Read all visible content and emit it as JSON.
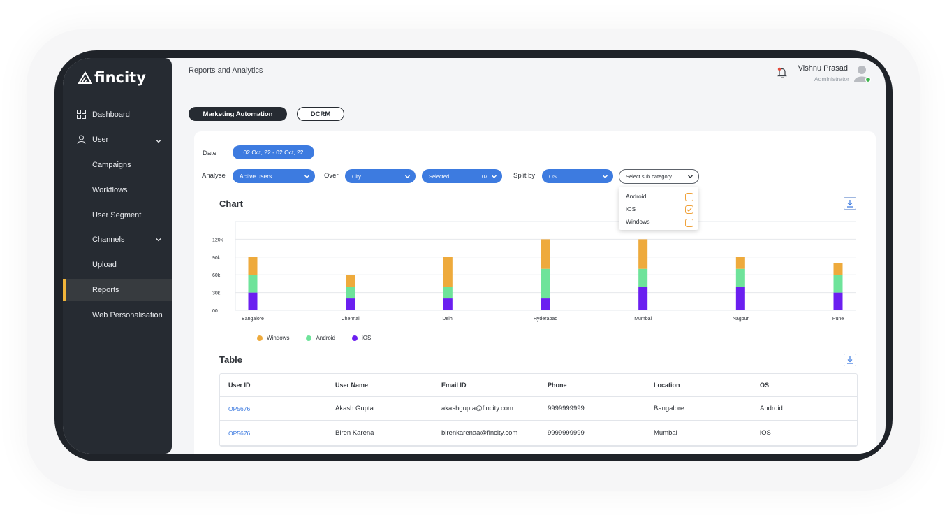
{
  "app": {
    "brand": "fincity",
    "page_title": "Reports and Analytics"
  },
  "user": {
    "name": "Vishnu Prasad",
    "role": "Administrator"
  },
  "sidebar": {
    "items": [
      {
        "label": "Dashboard",
        "icon": "grid-icon"
      },
      {
        "label": "User",
        "icon": "user-icon",
        "chevron": true
      },
      {
        "label": "Campaigns"
      },
      {
        "label": "Workflows"
      },
      {
        "label": "User Segment"
      },
      {
        "label": "Channels",
        "chevron": true
      },
      {
        "label": "Upload"
      },
      {
        "label": "Reports",
        "active": true
      },
      {
        "label": "Web Personalisation"
      }
    ]
  },
  "tabs": [
    {
      "label": "Marketing Automation",
      "active": true
    },
    {
      "label": "DCRM",
      "active": false
    }
  ],
  "filters": {
    "date_label": "Date",
    "date_value": "02 Oct, 22 - 02 Oct, 22",
    "analyse_label": "Analyse",
    "analyse_value": "Active users",
    "over_label": "Over",
    "over_value": "City",
    "selected_label": "Selected",
    "selected_count": "07",
    "split_label": "Split by",
    "split_value": "OS",
    "subcategory_placeholder": "Select sub category",
    "subcategory_options": [
      {
        "label": "Android",
        "checked": false
      },
      {
        "label": "iOS",
        "checked": true
      },
      {
        "label": "Windows",
        "checked": false
      }
    ]
  },
  "chart_section_title": "Chart",
  "table_section_title": "Table",
  "chart_data": {
    "type": "bar",
    "stacked": true,
    "categories": [
      "Bangalore",
      "Chennai",
      "Delhi",
      "Hyderabad",
      "Mumbai",
      "Nagpur",
      "Pune"
    ],
    "series": [
      {
        "name": "iOS",
        "color": "#6b1ff0",
        "values": [
          30000,
          20000,
          20000,
          20000,
          40000,
          40000,
          30000
        ]
      },
      {
        "name": "Android",
        "color": "#6ee39a",
        "values": [
          30000,
          20000,
          20000,
          50000,
          30000,
          30000,
          30000
        ]
      },
      {
        "name": "Windows",
        "color": "#eeaa3c",
        "values": [
          30000,
          20000,
          50000,
          50000,
          50000,
          20000,
          20000
        ]
      }
    ],
    "ytick_labels": [
      "00",
      "30k",
      "60k",
      "90k",
      "120k"
    ],
    "ytick_values": [
      0,
      30000,
      60000,
      90000,
      120000
    ],
    "ylim": [
      0,
      150000
    ],
    "legend_order": [
      "Windows",
      "Android",
      "iOS"
    ],
    "legend_position": "bottom-left",
    "grid": true
  },
  "table": {
    "columns": [
      "User ID",
      "User Name",
      "Email ID",
      "Phone",
      "Location",
      "OS"
    ],
    "rows": [
      [
        "OP5676",
        "Akash Gupta",
        "akashgupta@fincity.com",
        "9999999999",
        "Bangalore",
        "Android"
      ],
      [
        "OP5676",
        "Biren Karena",
        "birenkarenaa@fincity.com",
        "9999999999",
        "Mumbai",
        "iOS"
      ]
    ]
  },
  "colors": {
    "accent": "#3d7be0",
    "sidebar": "#262b32",
    "active_marker": "#f0b43a",
    "checkbox": "#f0a23a"
  }
}
